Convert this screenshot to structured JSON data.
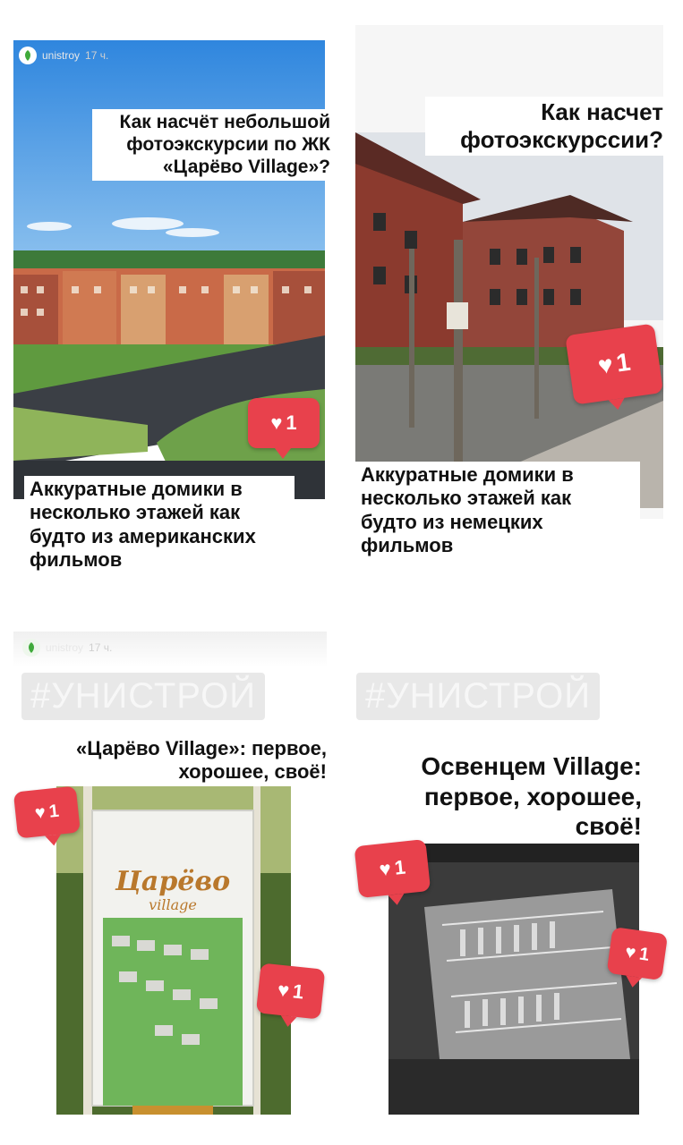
{
  "panel1": {
    "account": "unistroy",
    "time": "17 ч.",
    "headline": [
      "Как насчёт небольшой",
      "фотоэкскурсии по ЖК",
      "«Царёво Village»?"
    ],
    "caption": [
      "Аккуратные домики в",
      "несколько этажей как",
      "будто из американских",
      "фильмов"
    ],
    "likes": "1"
  },
  "panel2": {
    "headline": [
      "Как насчет",
      "фотоэкскурссии?"
    ],
    "caption": [
      "Аккуратные домики в",
      "несколько этажей как",
      "будто из немецких",
      "фильмов"
    ],
    "likes": "1"
  },
  "panel3": {
    "account": "unistroy",
    "time": "17 ч.",
    "tag": "#УНИСТРОЙ",
    "headline": [
      "«Царёво Village»: первое,",
      "хорошее, своё!"
    ],
    "sign_title": "Царёво",
    "sign_sub": "village",
    "likes": [
      "1",
      "1"
    ]
  },
  "panel4": {
    "tag": "#УНИСТРОЙ",
    "headline": [
      "Освенцем Village:",
      "первое, хорошее,",
      "своё!"
    ],
    "likes": [
      "1",
      "1"
    ]
  },
  "colors": {
    "like": "#e8414c",
    "sky": "#3d8fe0",
    "brick": "#8b3a2e"
  },
  "icons": [
    "heart-icon",
    "leaf-logo-icon"
  ]
}
